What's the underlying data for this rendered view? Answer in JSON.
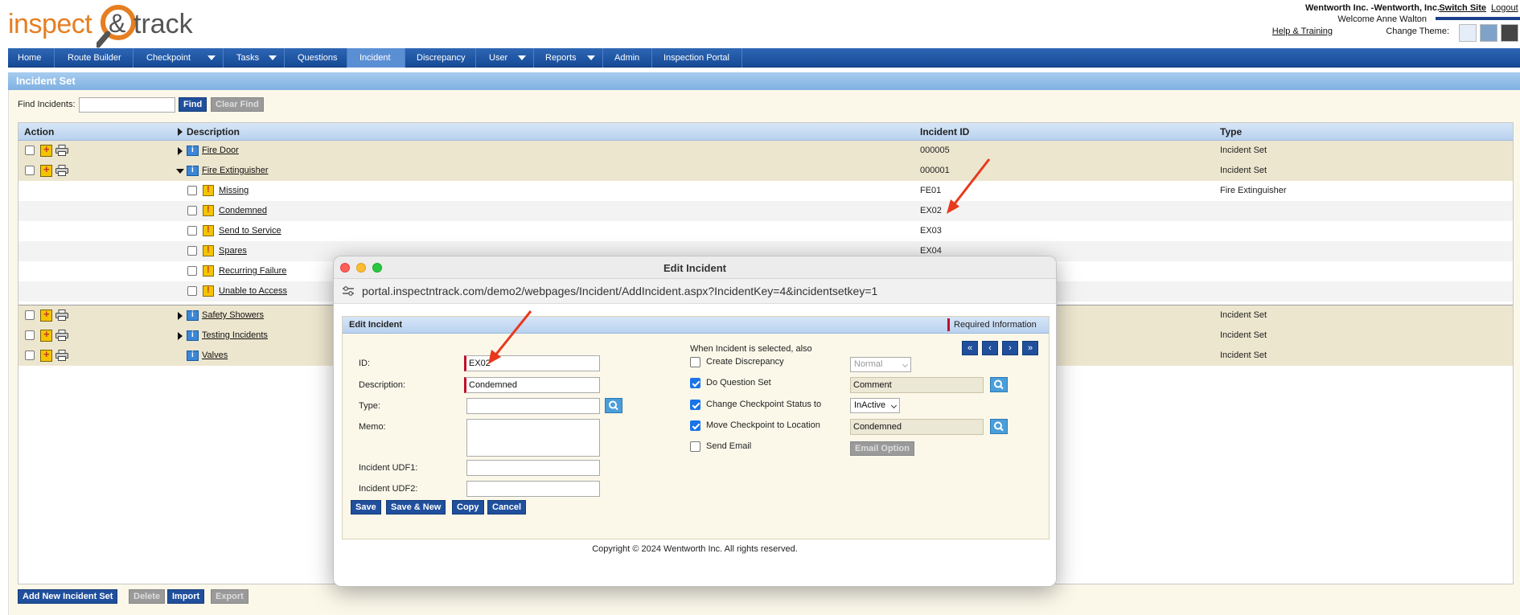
{
  "header": {
    "logo_part1": "inspect",
    "logo_part2": "track",
    "site_name": "Wentworth Inc. -Wentworth, Inc.",
    "switch_site": "Switch Site",
    "logout": "Logout",
    "welcome": "Welcome Anne Walton",
    "help": "Help & Training",
    "change_theme": "Change Theme:",
    "theme_colors": [
      "#e4edf8",
      "#7fa2c8",
      "#444444"
    ]
  },
  "nav": {
    "items": [
      {
        "label": "Home"
      },
      {
        "label": "Route Builder"
      },
      {
        "label": "Checkpoint"
      },
      {
        "label": "Tasks"
      },
      {
        "label": "Questions"
      },
      {
        "label": "Incident"
      },
      {
        "label": "Discrepancy"
      },
      {
        "label": "User"
      },
      {
        "label": "Reports"
      },
      {
        "label": "Admin"
      },
      {
        "label": "Inspection Portal"
      }
    ]
  },
  "page": {
    "title": "Incident Set",
    "find_label": "Find Incidents:",
    "find_value": "",
    "find_button": "Find",
    "clear_button": "Clear Find"
  },
  "table": {
    "headers": {
      "action": "Action",
      "description": "Description",
      "incident_id": "Incident ID",
      "type": "Type"
    },
    "rows": [
      {
        "description": "Fire Door",
        "incident_id": "000005",
        "type": "Incident Set"
      },
      {
        "description": "Fire Extinguisher",
        "incident_id": "000001",
        "type": "Incident Set"
      },
      {
        "description": "Missing",
        "incident_id": "FE01",
        "type": "Fire Extinguisher"
      },
      {
        "description": "Condemned",
        "incident_id": "EX02",
        "type": ""
      },
      {
        "description": "Send to Service",
        "incident_id": "EX03",
        "type": ""
      },
      {
        "description": "Spares",
        "incident_id": "EX04",
        "type": ""
      },
      {
        "description": "Recurring Failure",
        "incident_id": "",
        "type": ""
      },
      {
        "description": "Unable to Access",
        "incident_id": "",
        "type": ""
      },
      {
        "description": "Safety Showers",
        "incident_id": "",
        "type": "Incident Set"
      },
      {
        "description": "Testing Incidents",
        "incident_id": "",
        "type": "Incident Set"
      },
      {
        "description": "Valves",
        "incident_id": "",
        "type": "Incident Set"
      }
    ]
  },
  "bottom_buttons": {
    "add_set": "Add New Incident Set",
    "delete": "Delete",
    "import": "Import",
    "export": "Export"
  },
  "modal": {
    "window_title": "Edit Incident",
    "url": "portal.inspectntrack.com/demo2/webpages/Incident/AddIncident.aspx?IncidentKey=4&incidentsetkey=1",
    "panel_title": "Edit Incident",
    "required_info": "Required Information",
    "pager": {
      "first": "«",
      "prev": "‹",
      "next": "›",
      "last": "»"
    },
    "form": {
      "id_label": "ID:",
      "id_value": "EX02",
      "description_label": "Description:",
      "description_value": "Condemned",
      "type_label": "Type:",
      "type_value": "",
      "memo_label": "Memo:",
      "memo_value": "",
      "udf1_label": "Incident UDF1:",
      "udf1_value": "",
      "udf2_label": "Incident UDF2:",
      "udf2_value": ""
    },
    "options": {
      "heading": "When Incident is selected, also",
      "create_discrepancy": "Create Discrepancy",
      "do_question_set": "Do Question Set",
      "change_status": "Change Checkpoint Status to",
      "move_checkpoint": "Move Checkpoint to Location",
      "send_email": "Send Email",
      "priority_value": "Normal",
      "question_set_value": "Comment",
      "status_value": "InActive",
      "location_value": "Condemned",
      "email_option": "Email Option"
    },
    "buttons": {
      "save": "Save",
      "save_new": "Save & New",
      "copy": "Copy",
      "cancel": "Cancel"
    },
    "copyright": "Copyright © 2024 Wentworth Inc. All rights reserved."
  },
  "colors": {
    "nav_blue": "#1c54a3",
    "button_blue": "#204f9c",
    "annotation_red": "#e8391e",
    "row_parent": "#ede6cf",
    "panel_bg": "#fbf8ea"
  }
}
